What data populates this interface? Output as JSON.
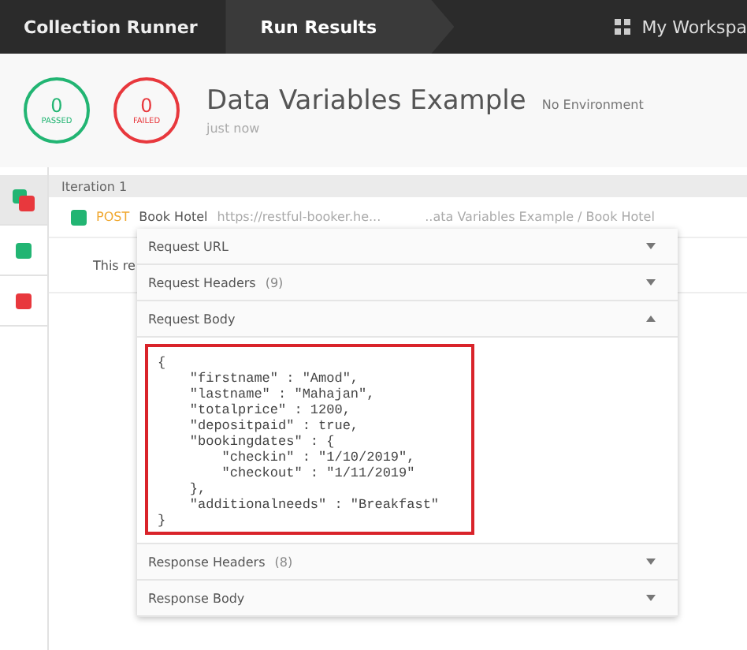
{
  "top_bar": {
    "tabs": [
      {
        "label": "Collection Runner",
        "selected": false
      },
      {
        "label": "Run Results",
        "selected": true
      }
    ],
    "workspace": "My Workspa"
  },
  "summary": {
    "passed": {
      "count": "0",
      "label": "PASSED"
    },
    "failed": {
      "count": "0",
      "label": "FAILED"
    },
    "title": "Data Variables Example",
    "environment": "No Environment",
    "time": "just now"
  },
  "sidebar": {
    "items": [
      {
        "kind": "mixed",
        "selected": true
      },
      {
        "kind": "pass",
        "selected": false
      },
      {
        "kind": "fail",
        "selected": false
      }
    ]
  },
  "iteration": {
    "label": "Iteration 1"
  },
  "request": {
    "method": "POST",
    "name": "Book Hotel",
    "url": "https://restful-booker.he...",
    "path": "..ata Variables Example / Book Hotel",
    "color": "#22b573"
  },
  "note": "This re",
  "panel": {
    "sections": [
      {
        "label": "Request URL",
        "expanded": false
      },
      {
        "label": "Request Headers",
        "count": "(9)",
        "expanded": false
      },
      {
        "label": "Request Body",
        "expanded": true,
        "body": [
          "{",
          "    \"firstname\" : \"Amod\",",
          "    \"lastname\" : \"Mahajan\",",
          "    \"totalprice\" : 1200,",
          "    \"depositpaid\" : true,",
          "    \"bookingdates\" : {",
          "        \"checkin\" : \"1/10/2019\",",
          "        \"checkout\" : \"1/11/2019\"",
          "    },",
          "    \"additionalneeds\" : \"Breakfast\"",
          "}"
        ]
      },
      {
        "label": "Response Headers",
        "count": "(8)",
        "expanded": false
      },
      {
        "label": "Response Body",
        "expanded": false
      }
    ]
  }
}
